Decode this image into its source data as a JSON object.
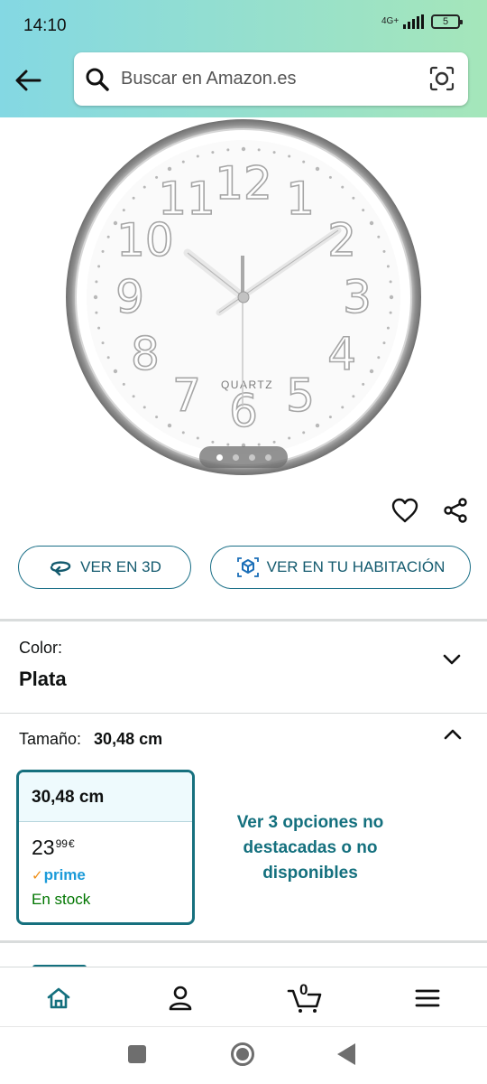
{
  "status_bar": {
    "time": "14:10",
    "network": "4G+",
    "battery": "5"
  },
  "search": {
    "placeholder": "Buscar en Amazon.es"
  },
  "product_image": {
    "brand_text": "QUARTZ",
    "numbers": [
      "12",
      "1",
      "2",
      "3",
      "4",
      "5",
      "6",
      "7",
      "8",
      "9",
      "10",
      "11"
    ],
    "carousel_total": 4,
    "carousel_active": 1
  },
  "actions": {
    "view_3d": "VER EN 3D",
    "view_in_room": "VER EN TU HABITACIÓN"
  },
  "color": {
    "label": "Color:",
    "value": "Plata"
  },
  "size": {
    "label": "Tamaño:",
    "value": "30,48 cm",
    "option": {
      "name": "30,48 cm",
      "price_whole": "23",
      "price_fraction": "99",
      "currency": "€",
      "prime": "prime",
      "stock": "En stock"
    },
    "more_options": "Ver 3 opciones no destacadas o no disponibles"
  },
  "bottom_nav": {
    "cart_count": "0"
  },
  "colors": {
    "accent": "#14707e",
    "prime_blue": "#1c9bd9",
    "in_stock": "#007600",
    "header_from": "#84d8e3",
    "header_to": "#a5e6ba"
  }
}
